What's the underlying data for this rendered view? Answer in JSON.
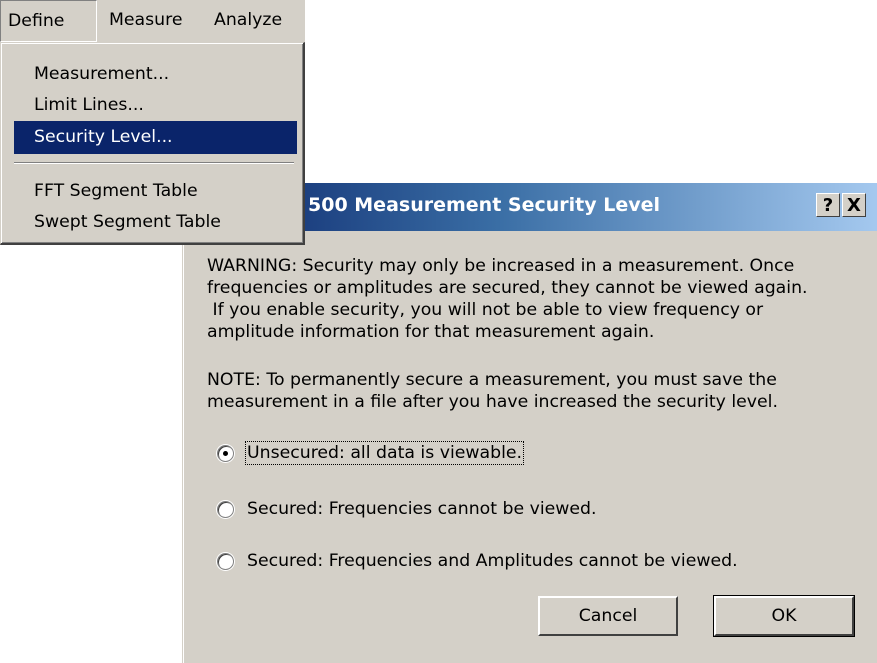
{
  "menubar": {
    "define": "Define",
    "measure": "Measure",
    "analyze": "Analyze"
  },
  "define_menu": {
    "items": [
      "Measurement...",
      "Limit Lines...",
      "Security Level...",
      "FFT Segment Table",
      "Swept Segment Table"
    ],
    "highlighted": "Security Level..."
  },
  "dialog": {
    "title": "500 Measurement Security Level",
    "help_glyph": "?",
    "close_glyph": "X",
    "warning_lines": [
      "WARNING: Security may only be increased in a measurement.  Once",
      "frequencies or amplitudes are secured, they cannot be viewed again.",
      " If you enable security, you will not be able to view frequency or",
      "amplitude information for that measurement again."
    ],
    "note_lines": [
      "NOTE: To permanently secure a measurement, you must save the",
      "measurement in a file after you have increased the security level."
    ],
    "options": [
      {
        "label": "Unsecured: all data is viewable.",
        "selected": true
      },
      {
        "label": "Secured: Frequencies cannot be viewed.",
        "selected": false
      },
      {
        "label": "Secured: Frequencies and Amplitudes cannot be viewed.",
        "selected": false
      }
    ],
    "cancel_label": "Cancel",
    "ok_label": "OK"
  },
  "colors": {
    "face": "#d4d0c8",
    "highlight": "#0a246a",
    "title_gradient_start": "#0a246a",
    "title_gradient_end": "#a6caf0"
  }
}
